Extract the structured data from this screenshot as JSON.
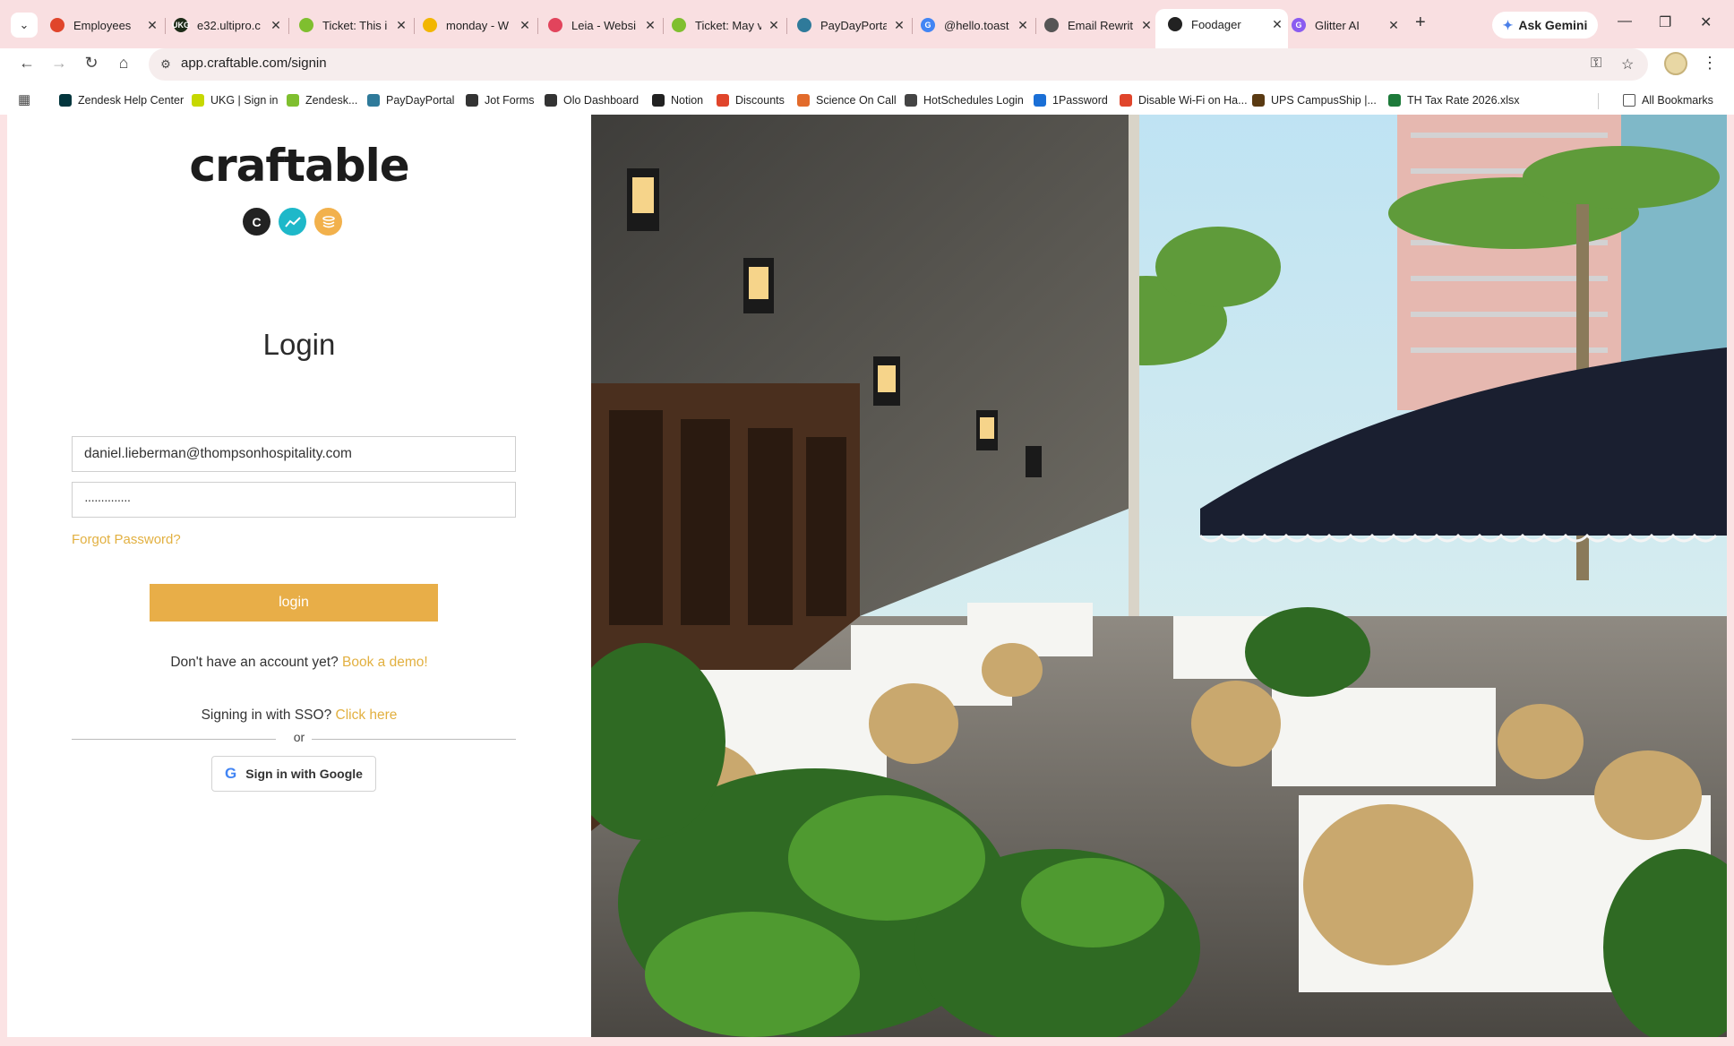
{
  "browser": {
    "tabs": [
      {
        "label": "Employees",
        "fav_color": "#e0452b",
        "fav_text": ""
      },
      {
        "label": "e32.ultipro.c",
        "fav_color": "#1d2b18",
        "fav_text": "UKG"
      },
      {
        "label": "Ticket: This i",
        "fav_color": "#7fbf2f",
        "fav_text": ""
      },
      {
        "label": "monday - W",
        "fav_color": "#f2b600",
        "fav_text": ""
      },
      {
        "label": "Leia - Websi",
        "fav_color": "#e2445c",
        "fav_text": ""
      },
      {
        "label": "Ticket: May v",
        "fav_color": "#7fbf2f",
        "fav_text": ""
      },
      {
        "label": "PayDayPorta",
        "fav_color": "#2f7a9a",
        "fav_text": ""
      },
      {
        "label": "@hello.toast",
        "fav_color": "#4285f4",
        "fav_text": "G"
      },
      {
        "label": "Email Rewrit",
        "fav_color": "#555555",
        "fav_text": ""
      },
      {
        "label": "Foodager",
        "fav_color": "#222222",
        "fav_text": ""
      },
      {
        "label": "Glitter AI",
        "fav_color": "#8a5cf0",
        "fav_text": "G"
      }
    ],
    "ask_gemini": "Ask Gemini",
    "url": "app.craftable.com/signin",
    "bookmarks": [
      {
        "label": "Zendesk Help Center",
        "color": "#03363d"
      },
      {
        "label": "UKG | Sign in",
        "color": "#c6d800"
      },
      {
        "label": "Zendesk...",
        "color": "#7fbf2f"
      },
      {
        "label": "PayDayPortal",
        "color": "#2f7a9a"
      },
      {
        "label": "Jot Forms",
        "color": "#333333"
      },
      {
        "label": "Olo Dashboard",
        "color": "#333333"
      },
      {
        "label": "Notion",
        "color": "#222222"
      },
      {
        "label": "Discounts",
        "color": "#e0452b"
      },
      {
        "label": "Science On Call",
        "color": "#e26b2b"
      },
      {
        "label": "HotSchedules Login",
        "color": "#444444"
      },
      {
        "label": "1Password",
        "color": "#1a6fd6"
      },
      {
        "label": "Disable Wi-Fi on Ha...",
        "color": "#e0452b"
      },
      {
        "label": "UPS CampusShip |...",
        "color": "#5a3a12"
      },
      {
        "label": "TH Tax Rate 2026.xlsx",
        "color": "#1d7a3a"
      }
    ],
    "all_bookmarks": "All Bookmarks"
  },
  "login": {
    "logo": "craftable",
    "title": "Login",
    "email_value": "daniel.lieberman@thompsonhospitality.com",
    "password_value": "··············",
    "forgot": "Forgot Password?",
    "button": "login",
    "no_account": "Don't have an account yet?",
    "book_demo": "Book a demo!",
    "sso": "Signing in with SSO?",
    "click_here": "Click here",
    "or": "or",
    "google": "Sign in with Google"
  },
  "colors": {
    "accent": "#e8ae48",
    "link": "#e2b040",
    "tabstrip": "#f9dfe1"
  }
}
